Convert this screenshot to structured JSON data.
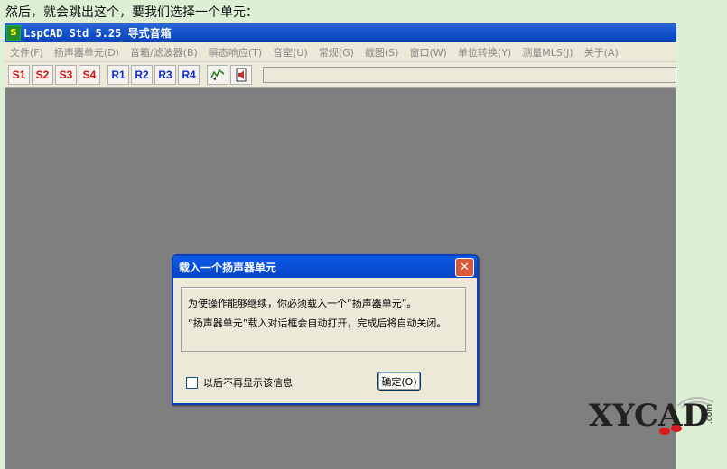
{
  "caption": "然后，就会跳出这个，要我们选择一个单元：",
  "window": {
    "icon_text": "S",
    "title": "LspCAD Std 5.25 导式音箱",
    "menu": [
      "文件(F)",
      "扬声器单元(D)",
      "音箱/滤波器(B)",
      "瞬态响应(T)",
      "音室(U)",
      "常规(G)",
      "截图(S)",
      "窗口(W)",
      "单位转换(Y)",
      "测量MLS(J)",
      "关于(A)"
    ],
    "toolbar": {
      "s_buttons": [
        "S1",
        "S2",
        "S3",
        "S4"
      ],
      "r_buttons": [
        "R1",
        "R2",
        "R3",
        "R4"
      ],
      "icons": [
        "chart-icon",
        "speaker-icon"
      ]
    }
  },
  "dialog": {
    "title": "载入一个扬声器单元",
    "close_glyph": "✕",
    "line1": "为使操作能够继续，你必须载入一个“扬声器单元”。",
    "line2": "“扬声器单元”载入对话框会自动打开，完成后将自动关闭。",
    "checkbox_label": "以后不再显示该信息",
    "ok_label": "确定(O)"
  },
  "watermark": {
    "text": "XYCAD",
    "suffix": ".com"
  }
}
